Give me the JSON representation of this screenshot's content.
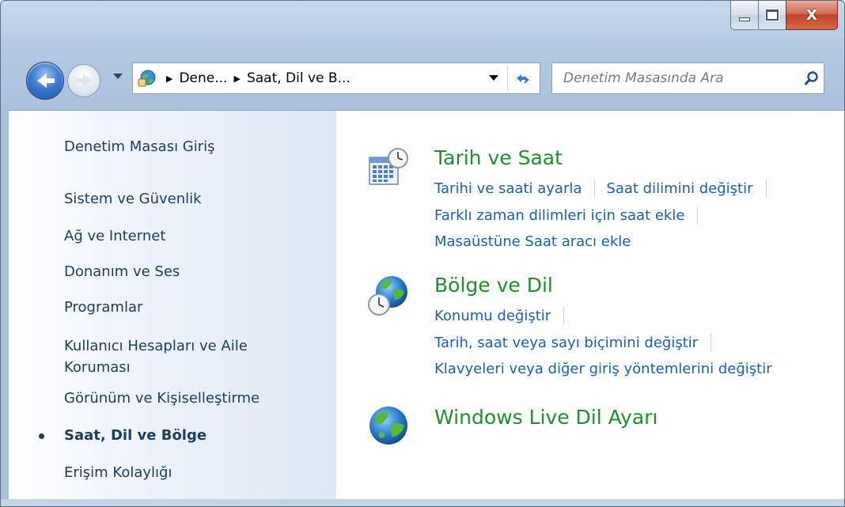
{
  "window": {
    "caption": {
      "minimize_icon": "minimize-icon",
      "maximize_icon": "maximize-icon",
      "close_label": "X"
    }
  },
  "nav": {
    "breadcrumb": [
      "Dene...",
      "Saat, Dil ve B..."
    ],
    "search_placeholder": "Denetim Masasında Ara"
  },
  "sidebar": {
    "items": [
      {
        "label": "Denetim Masası Giriş"
      },
      {
        "label": "Sistem ve Güvenlik"
      },
      {
        "label": "Ağ ve Internet"
      },
      {
        "label": "Donanım ve Ses"
      },
      {
        "label": "Programlar"
      },
      {
        "label": "Kullanıcı Hesapları ve Aile",
        "label2": "Koruması"
      },
      {
        "label": "Görünüm ve Kişiselleştirme"
      },
      {
        "label": "Saat, Dil ve Bölge",
        "active": true
      },
      {
        "label": "Erişim Kolaylığı"
      }
    ]
  },
  "main": {
    "categories": [
      {
        "title": "Tarih ve Saat",
        "icon": "calendar-clock-icon",
        "links": [
          [
            "Tarihi ve saati ayarla",
            "Saat dilimini değiştir"
          ],
          [
            "Farklı zaman dilimleri için saat ekle"
          ],
          [
            "Masaüstüne Saat aracı ekle"
          ]
        ]
      },
      {
        "title": "Bölge ve Dil",
        "icon": "globe-clock-icon",
        "links": [
          [
            "Konumu değiştir"
          ],
          [
            "Tarih, saat veya sayı biçimini değiştir"
          ],
          [
            "Klavyeleri veya diğer giriş yöntemlerini değiştir"
          ]
        ]
      },
      {
        "title": "Windows Live Dil Ayarı",
        "icon": "globe-icon",
        "links": []
      }
    ]
  },
  "colors": {
    "link": "#1a5fb4",
    "category_title": "#1e8f2e",
    "sidebar_text": "#1e3d61"
  }
}
